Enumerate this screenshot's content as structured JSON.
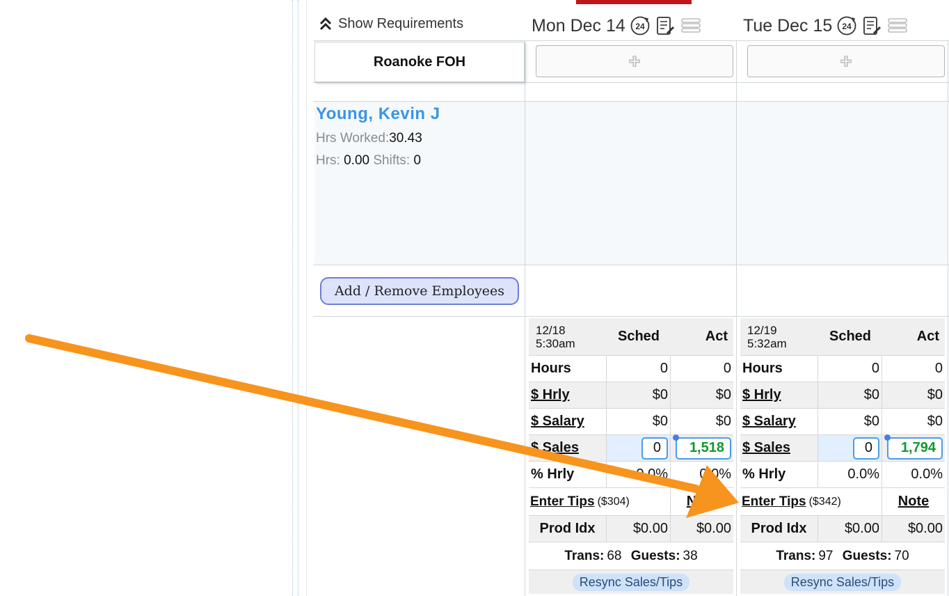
{
  "header": {
    "show_requirements": "Show Requirements",
    "dept_name": "Roanoke FOH",
    "days": [
      {
        "label": "Mon Dec 14",
        "badge": "24"
      },
      {
        "label": "Tue Dec 15",
        "badge": "24"
      }
    ]
  },
  "employee": {
    "name": "Young, Kevin J",
    "hrs_worked_label": "Hrs Worked:",
    "hrs_worked_value": "30.43",
    "hrs_label": "Hrs:",
    "hrs_value": "0.00",
    "shifts_label": "Shifts:",
    "shifts_value": "0"
  },
  "add_remove_label": "Add / Remove Employees",
  "summary": {
    "col_sched": "Sched",
    "col_act": "Act",
    "hours_label": "Hours",
    "hrly_label": "$ Hrly",
    "salary_label": "$ Salary",
    "sales_label": "$ Sales",
    "pct_hrly_label": "% Hrly",
    "enter_tips_label": "Enter Tips",
    "note_label": "Note",
    "prod_idx_label": "Prod Idx",
    "trans_label": "Trans:",
    "guests_label": "Guests:",
    "resync_label": "Resync Sales/Tips",
    "days": [
      {
        "date": "12/18",
        "time": "5:30am",
        "hours_sched": "0",
        "hours_act": "0",
        "hrly_sched": "$0",
        "hrly_act": "$0",
        "salary_sched": "$0",
        "salary_act": "$0",
        "sales_sched": "0",
        "sales_act": "1,518",
        "pct_sched": "0.0%",
        "pct_act": "0.0%",
        "tips_amount": "($304)",
        "prod_sched": "$0.00",
        "prod_act": "$0.00",
        "trans": "68",
        "guests": "38"
      },
      {
        "date": "12/19",
        "time": "5:32am",
        "hours_sched": "0",
        "hours_act": "0",
        "hrly_sched": "$0",
        "hrly_act": "$0",
        "salary_sched": "$0",
        "salary_act": "$0",
        "sales_sched": "0",
        "sales_act": "1,794",
        "pct_sched": "0.0%",
        "pct_act": "0.0%",
        "tips_amount": "($342)",
        "prod_sched": "$0.00",
        "prod_act": "$0.00",
        "trans": "97",
        "guests": "70"
      }
    ]
  },
  "colors": {
    "accent_red": "#c0141c",
    "name_blue": "#3a95e4",
    "sales_green": "#0e9a2c",
    "arrow_orange": "#f7941d"
  }
}
